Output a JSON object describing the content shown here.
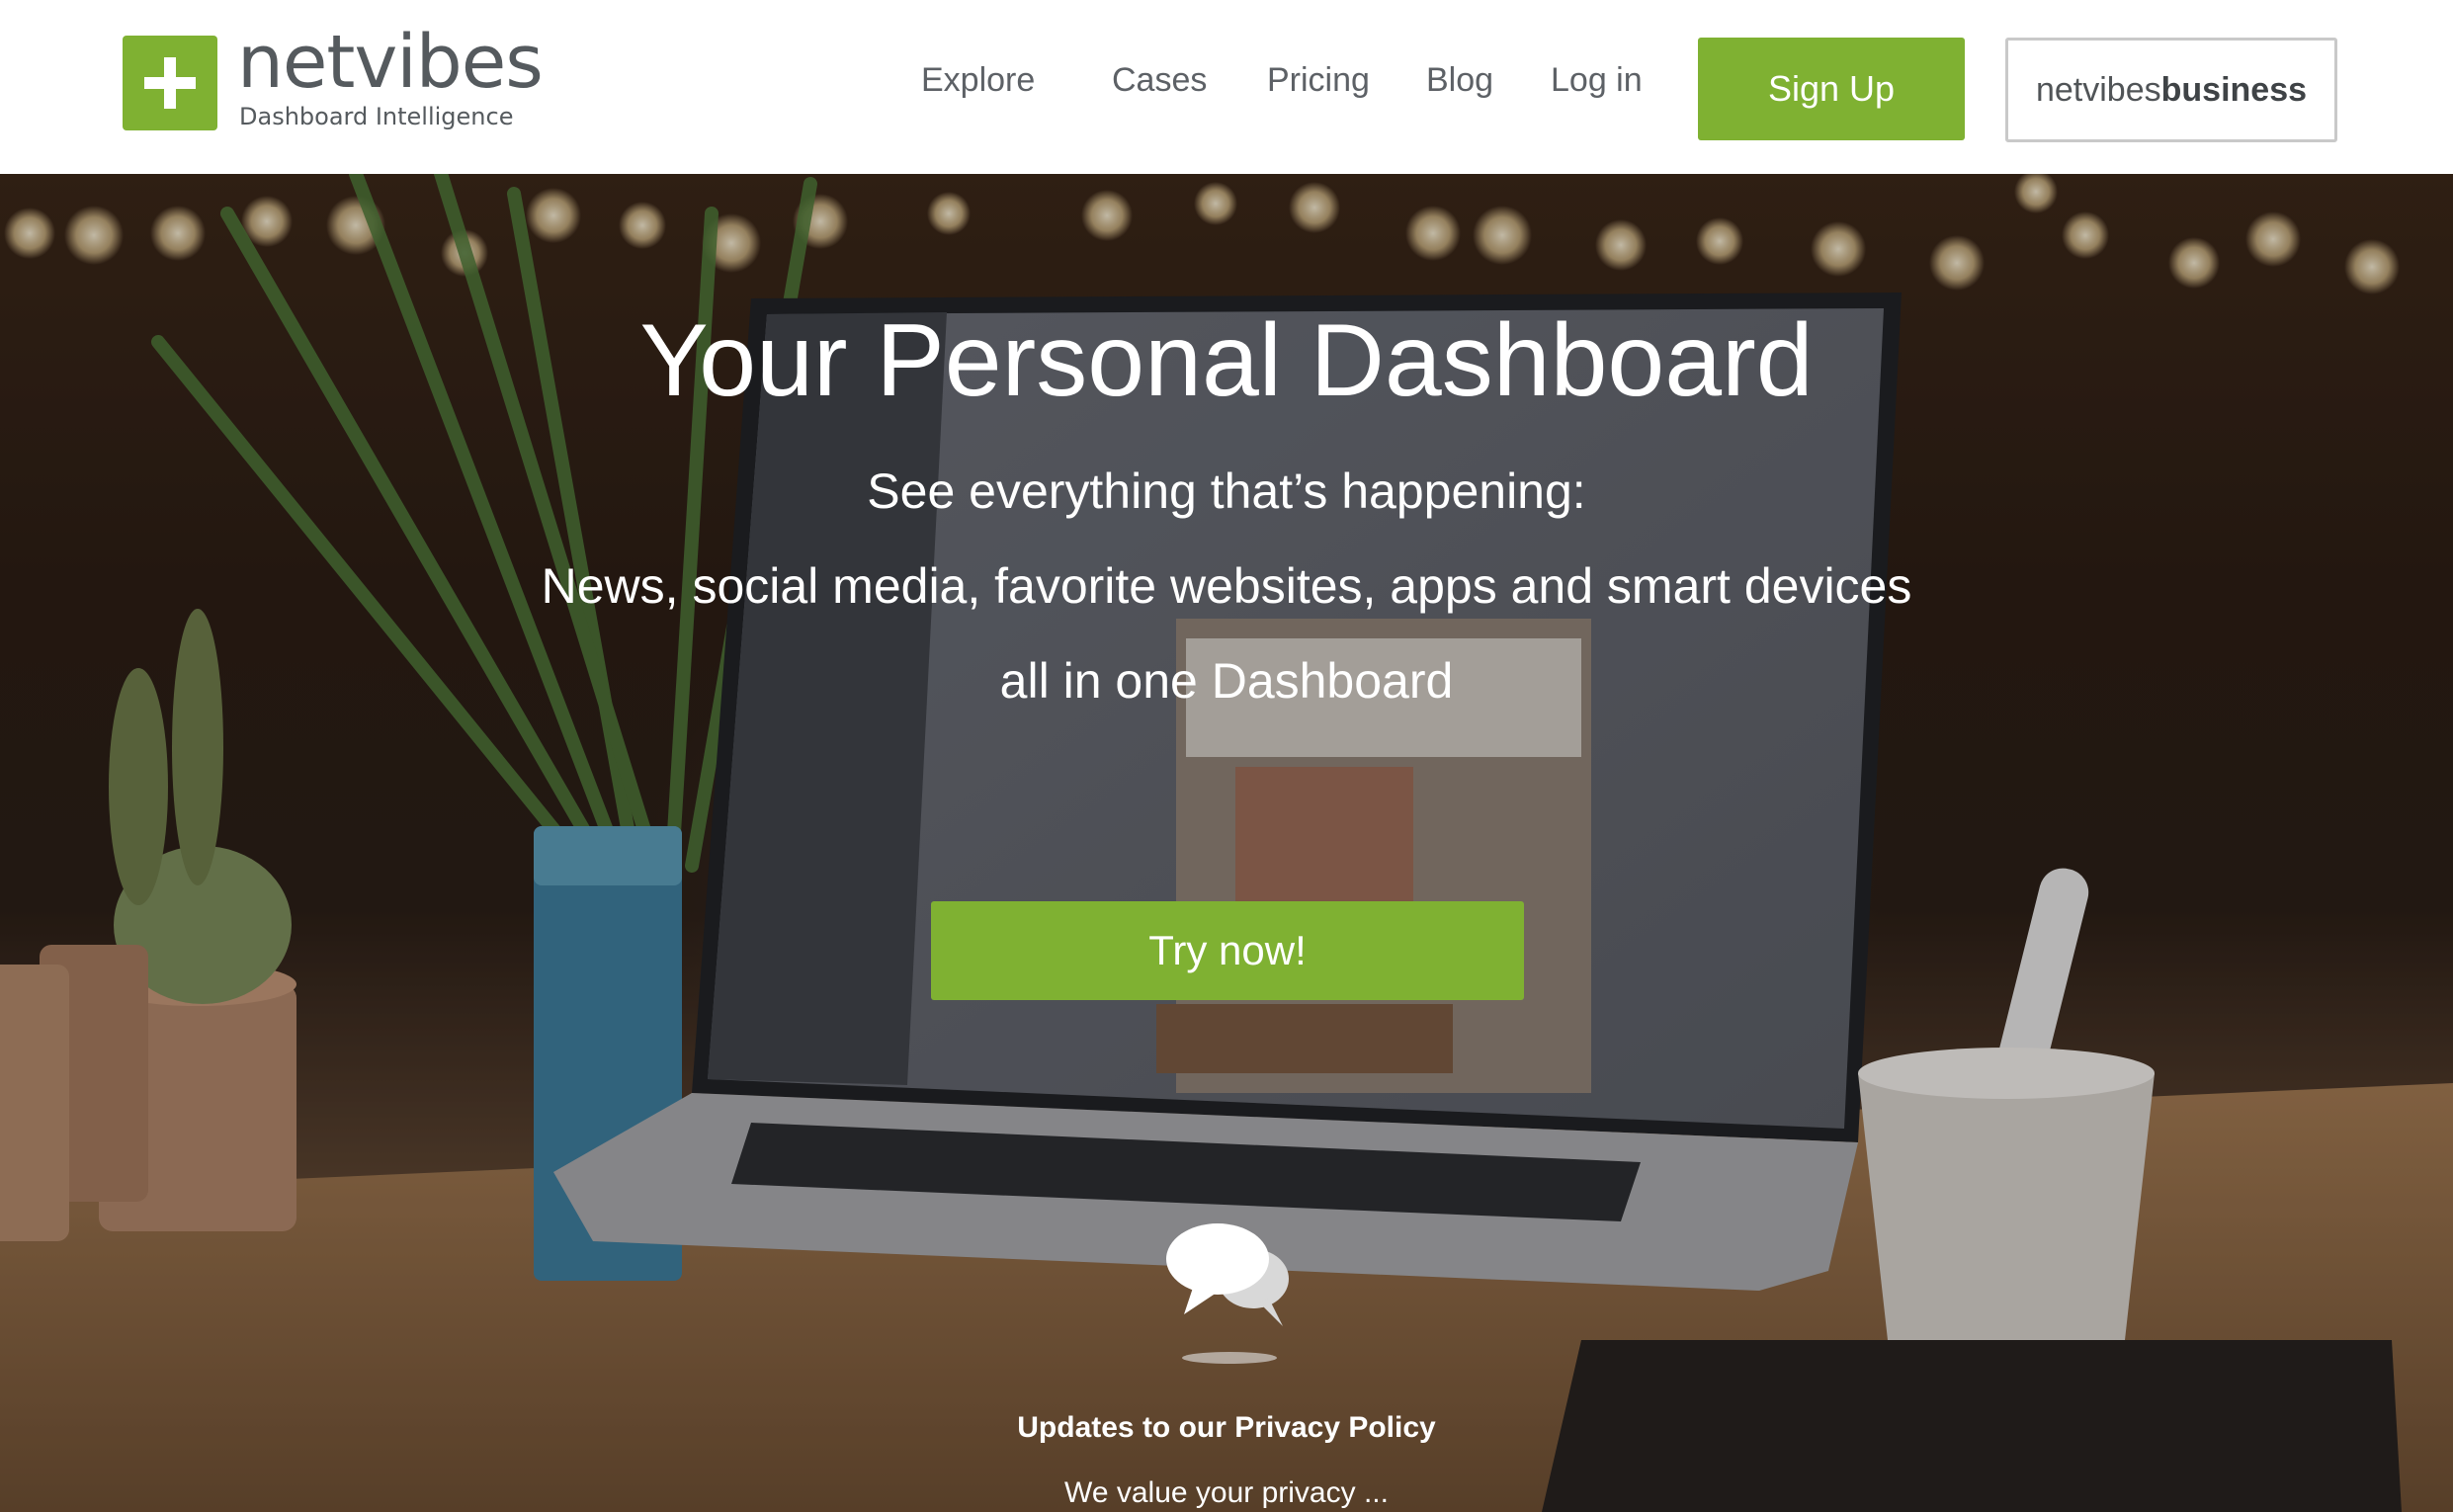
{
  "brand": {
    "name": "netvibes",
    "tagline": "Dashboard Intelligence",
    "accent": "#7fb132"
  },
  "nav": {
    "items": [
      {
        "label": "Explore"
      },
      {
        "label": "Cases"
      },
      {
        "label": "Pricing"
      },
      {
        "label": "Blog"
      },
      {
        "label": "Log in"
      }
    ],
    "signup_label": "Sign Up",
    "business_prefix": "netvibes",
    "business_suffix": "business"
  },
  "hero": {
    "title": "Your Personal Dashboard",
    "subtitle_1": "See everything that’s happening:",
    "subtitle_2": "News, social media, favorite websites, apps and smart devices",
    "subtitle_3": "all in one Dashboard",
    "cta_label": "Try now!"
  },
  "privacy": {
    "title": "Updates to our Privacy Policy",
    "text": "We value your privacy ..."
  },
  "icons": {
    "logo": "plus-icon",
    "chat": "speech-bubbles-icon"
  }
}
